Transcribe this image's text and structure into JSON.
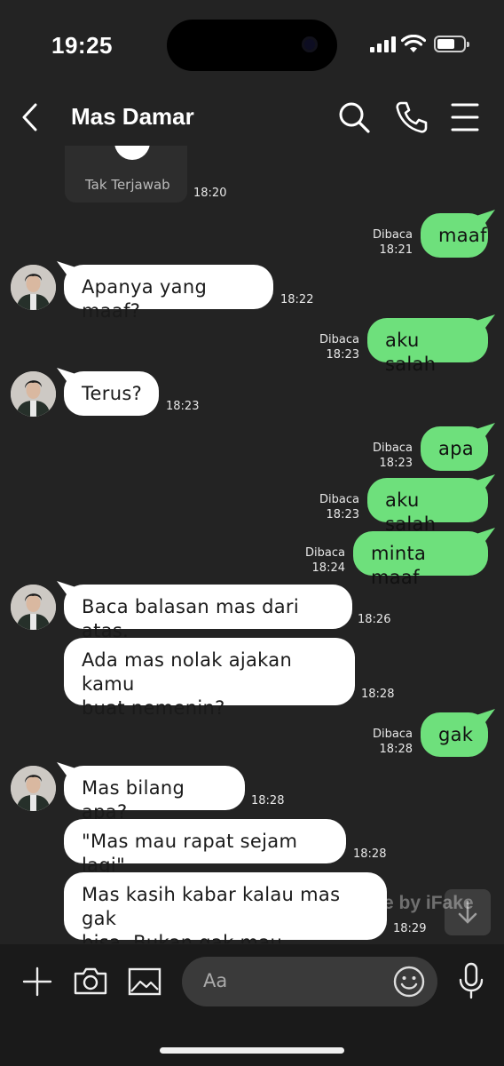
{
  "status": {
    "time": "19:25"
  },
  "header": {
    "title": "Mas Damar"
  },
  "call_card": {
    "label": "Tak Terjawab",
    "time": "18:20"
  },
  "messages": [
    {
      "dir": "out",
      "text": "maaf",
      "read": "Dibaca",
      "time": "18:21"
    },
    {
      "dir": "in",
      "text": "Apanya yang maaf?",
      "time": "18:22"
    },
    {
      "dir": "out",
      "text": "aku salah",
      "read": "Dibaca",
      "time": "18:23"
    },
    {
      "dir": "in",
      "text": "Terus?",
      "time": "18:23"
    },
    {
      "dir": "out",
      "text": "apa",
      "read": "Dibaca",
      "time": "18:23"
    },
    {
      "dir": "out",
      "text": "aku salah",
      "read": "Dibaca",
      "time": "18:23"
    },
    {
      "dir": "out",
      "text": "minta maaf",
      "read": "Dibaca",
      "time": "18:24"
    },
    {
      "dir": "in",
      "text": "Baca balasan mas dari atas.",
      "time": "18:26"
    },
    {
      "dir": "in",
      "text": "Ada mas nolak ajakan kamu\nbuat nemenin?",
      "time": "18:28"
    },
    {
      "dir": "out",
      "text": "gak",
      "read": "Dibaca",
      "time": "18:28"
    },
    {
      "dir": "in",
      "text": "Mas bilang apa?",
      "time": "18:28"
    },
    {
      "dir": "in",
      "text": "\"Mas mau rapat sejam lagi\"",
      "time": "18:28"
    },
    {
      "dir": "in",
      "text": "Mas kasih kabar kalau mas gak\nbisa. Bukan gak mau.",
      "time": "18:29"
    }
  ],
  "watermark": "Made by iFake",
  "input": {
    "placeholder": "Aa"
  },
  "colors": {
    "background": "#232323",
    "outgoing": "#6ee07c",
    "incoming": "#ffffff"
  }
}
